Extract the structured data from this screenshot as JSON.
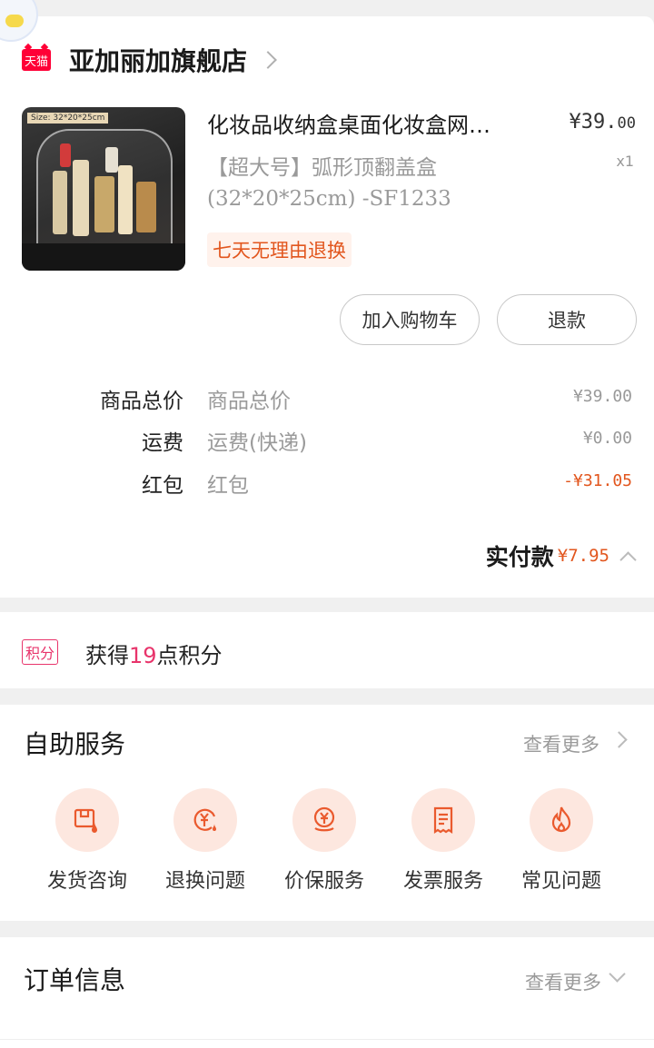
{
  "store": {
    "badge": "天猫",
    "name": "亚加丽加旗舰店"
  },
  "product": {
    "image_size_tag": "Size: 32*20*25cm",
    "title": "化妆品收纳盒桌面化妆盒网…",
    "price_main": "¥39.",
    "price_cents": "00",
    "qty": "x1",
    "sku_line1": "【超大号】弧形顶翻盖盒",
    "sku_line2": "(32*20*25cm) -SF1233",
    "return_tag": "七天无理由退换"
  },
  "buttons": {
    "add_cart": "加入购物车",
    "refund": "退款"
  },
  "fees": {
    "total_label": "商品总价",
    "total_desc": "商品总价",
    "total_value": "¥39.00",
    "ship_label": "运费",
    "ship_desc": "运费(快递)",
    "ship_value": "¥0.00",
    "red_label": "红包",
    "red_desc": "红包",
    "red_value": "-¥31.05"
  },
  "paid": {
    "label": "实付款",
    "value": "¥7.95"
  },
  "points": {
    "badge": "积分",
    "prefix": "获得",
    "count": "19",
    "suffix": "点积分"
  },
  "service": {
    "title": "自助服务",
    "more": "查看更多",
    "items": [
      {
        "label": "发货咨询",
        "icon": "shipping-icon"
      },
      {
        "label": "退换问题",
        "icon": "return-icon"
      },
      {
        "label": "价保服务",
        "icon": "price-protect-icon"
      },
      {
        "label": "发票服务",
        "icon": "invoice-icon"
      },
      {
        "label": "常见问题",
        "icon": "faq-icon"
      }
    ]
  },
  "order": {
    "title": "订单信息",
    "more": "查看更多"
  },
  "colors": {
    "accent": "#e2561e",
    "tmall": "#ff0036",
    "points": "#e8346b",
    "icon_bg": "#fde7df"
  }
}
